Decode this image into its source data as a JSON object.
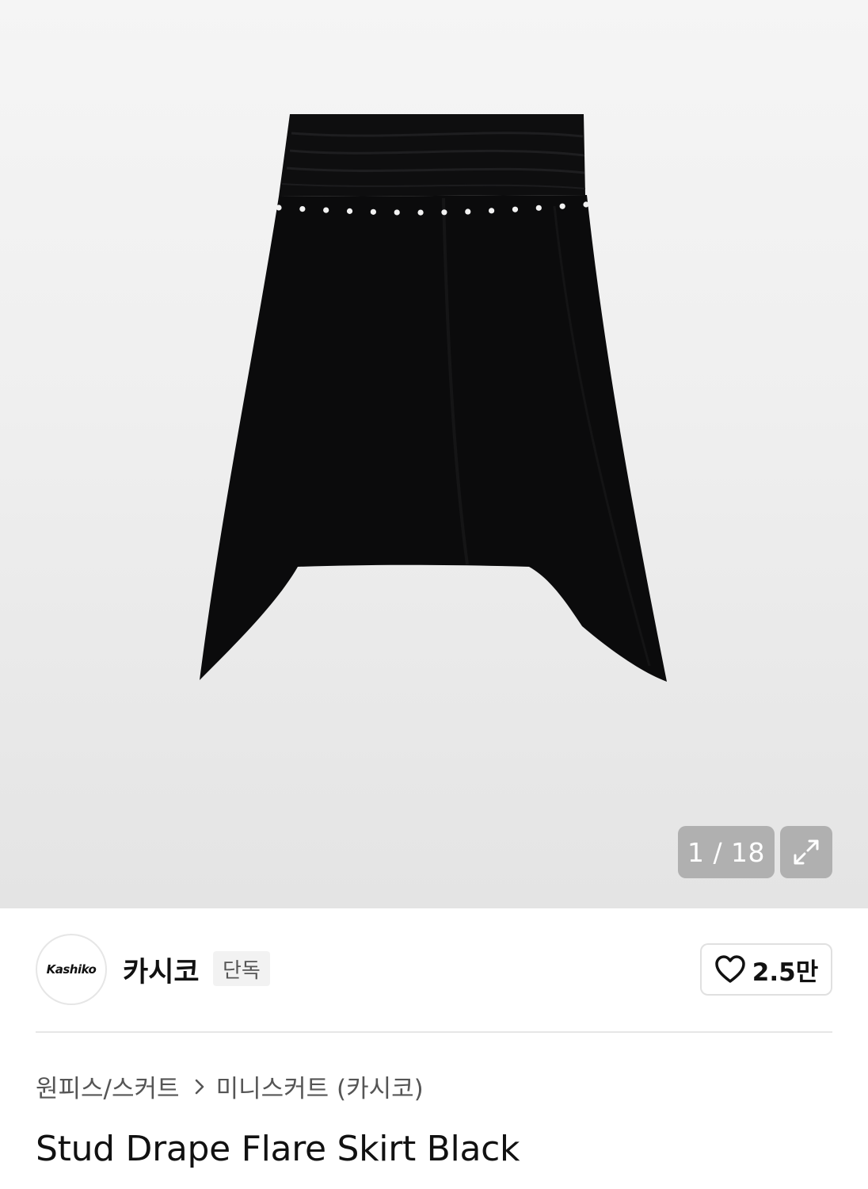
{
  "gallery": {
    "counter": "1 / 18",
    "image_subject": "black stud drape flare skirt"
  },
  "brand": {
    "logo_text": "Kashiko",
    "name": "카시코",
    "badge": "단독"
  },
  "like": {
    "count": "2.5만"
  },
  "breadcrumb": {
    "items": [
      "원피스/스커트",
      "미니스커트 (카시코)"
    ]
  },
  "product": {
    "title": "Stud Drape Flare Skirt Black"
  },
  "colors": {
    "skirt": "#0b0b0c",
    "stud": "#f2f2f2"
  }
}
